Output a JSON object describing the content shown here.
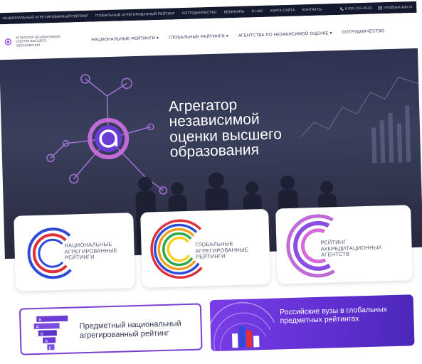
{
  "topbar": {
    "links": [
      "Национальный агрегированный рейтинг",
      "Глобальный агрегированный рейтинг",
      "Сотрудничество",
      "Вебинары",
      "О нас",
      "Карта сайта",
      "Контакты"
    ],
    "phone": "8 835 233-45-03",
    "email": "info@best-edu.ru"
  },
  "header": {
    "logo_text": "Агрегатор независимой оценки высшего образования",
    "nav": [
      "Национальные рейтинги",
      "Глобальные рейтинги",
      "Агентства по независимой оценке",
      "Сотрудничество"
    ],
    "dropdown_mark": "▾"
  },
  "hero": {
    "title_lines": [
      "Агрегатор",
      "независимой",
      "оценки высшего",
      "образования"
    ]
  },
  "cards": [
    {
      "label_lines": [
        "Национальные",
        "агрегированные",
        "рейтинги"
      ]
    },
    {
      "label_lines": [
        "Глобальные",
        "агрегированные",
        "рейтинги"
      ]
    },
    {
      "label_lines": [
        "Рейтинг",
        "аккредитационных",
        "агентств"
      ]
    }
  ],
  "banners": {
    "subject_national": "Предметный национальный агрегированный рейтинг",
    "russian_universities": "Российские вузы в глобальных предметных рейтингах",
    "chart_level_labels": [
      "B",
      "A",
      "B",
      "A",
      "B"
    ]
  },
  "colors": {
    "topbar_bg": "#15192e",
    "accent_purple": "#7b3fd0",
    "accent_blue": "#2d4bd8",
    "accent_red": "#e0303a"
  }
}
